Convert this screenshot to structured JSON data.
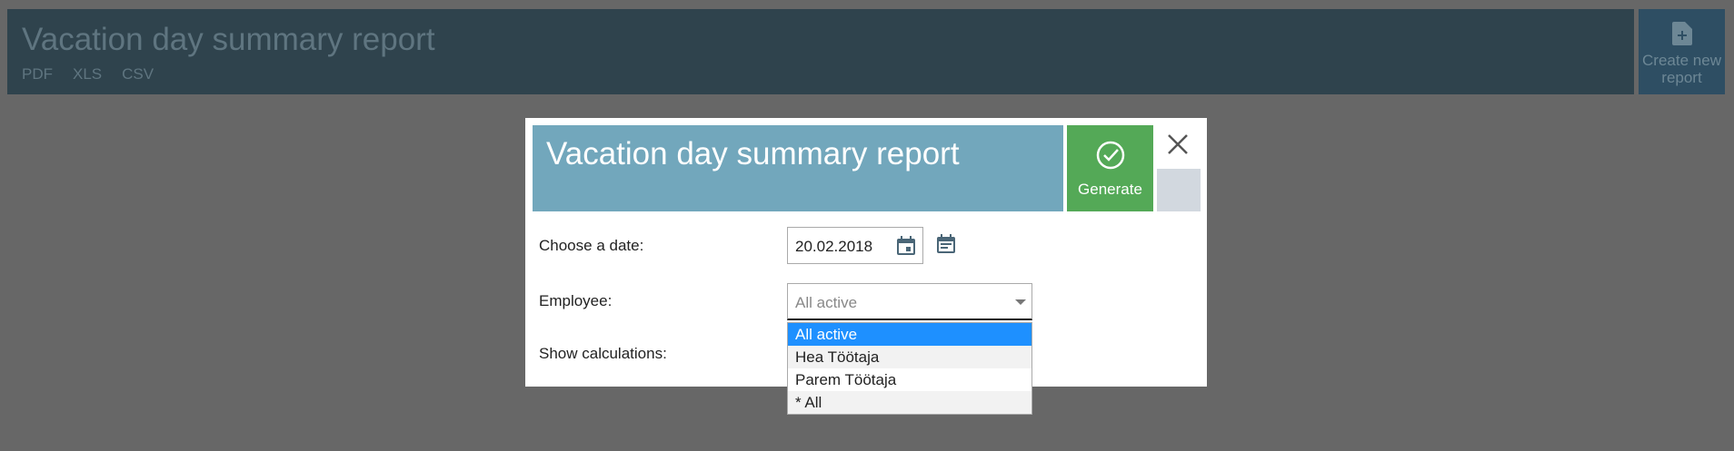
{
  "page": {
    "title": "Vacation day summary report",
    "exports": [
      "PDF",
      "XLS",
      "CSV"
    ],
    "create_report_label": "Create new report"
  },
  "modal": {
    "title": "Vacation day summary report",
    "generate_label": "Generate",
    "fields": {
      "date_label": "Choose a date:",
      "date_value": "20.02.2018",
      "employee_label": "Employee:",
      "employee_value": "All active",
      "calculations_label": "Show calculations:"
    },
    "employee_options": [
      "All active",
      "Hea Töötaja",
      "Parem Töötaja",
      "* All"
    ]
  },
  "colors": {
    "title_bar": "#72a7bc",
    "generate": "#54a957",
    "selected_option": "#1e90ff",
    "overlay": "#676767",
    "page_header": "#2f434d"
  }
}
